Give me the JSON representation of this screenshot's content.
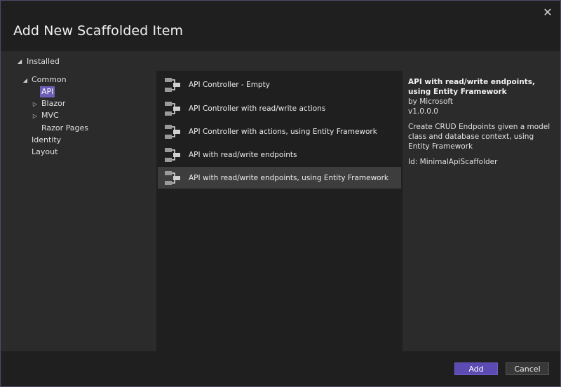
{
  "dialog": {
    "title": "Add New Scaffolded Item",
    "close_glyph": "✕"
  },
  "installed": {
    "label": "Installed",
    "arrow": "◢"
  },
  "tree": {
    "common": {
      "label": "Common",
      "arrow": "◢"
    },
    "api": {
      "label": "API"
    },
    "blazor": {
      "label": "Blazor",
      "arrow": "▷"
    },
    "mvc": {
      "label": "MVC",
      "arrow": "▷"
    },
    "razor_pages": {
      "label": "Razor Pages"
    },
    "identity": {
      "label": "Identity"
    },
    "layout": {
      "label": "Layout"
    }
  },
  "templates": [
    {
      "name": "API Controller - Empty",
      "icon": "controller-icon"
    },
    {
      "name": "API Controller with read/write actions",
      "icon": "controller-icon"
    },
    {
      "name": "API Controller with actions, using Entity Framework",
      "icon": "controller-icon"
    },
    {
      "name": "API with read/write endpoints",
      "icon": "controller-icon"
    },
    {
      "name": "API with read/write endpoints, using Entity Framework",
      "icon": "controller-icon"
    }
  ],
  "details": {
    "title": "API with read/write endpoints, using Entity Framework",
    "author": "by Microsoft",
    "version": "v1.0.0.0",
    "description": "Create CRUD Endpoints given a model class and database context, using Entity Framework",
    "id": "Id: MinimalApiScaffolder"
  },
  "buttons": {
    "add": "Add",
    "cancel": "Cancel"
  },
  "colors": {
    "accent": "#5b4bb2",
    "selection": "#6b5fb5",
    "background": "#1f1f1f",
    "panel": "#2b2b2b"
  }
}
